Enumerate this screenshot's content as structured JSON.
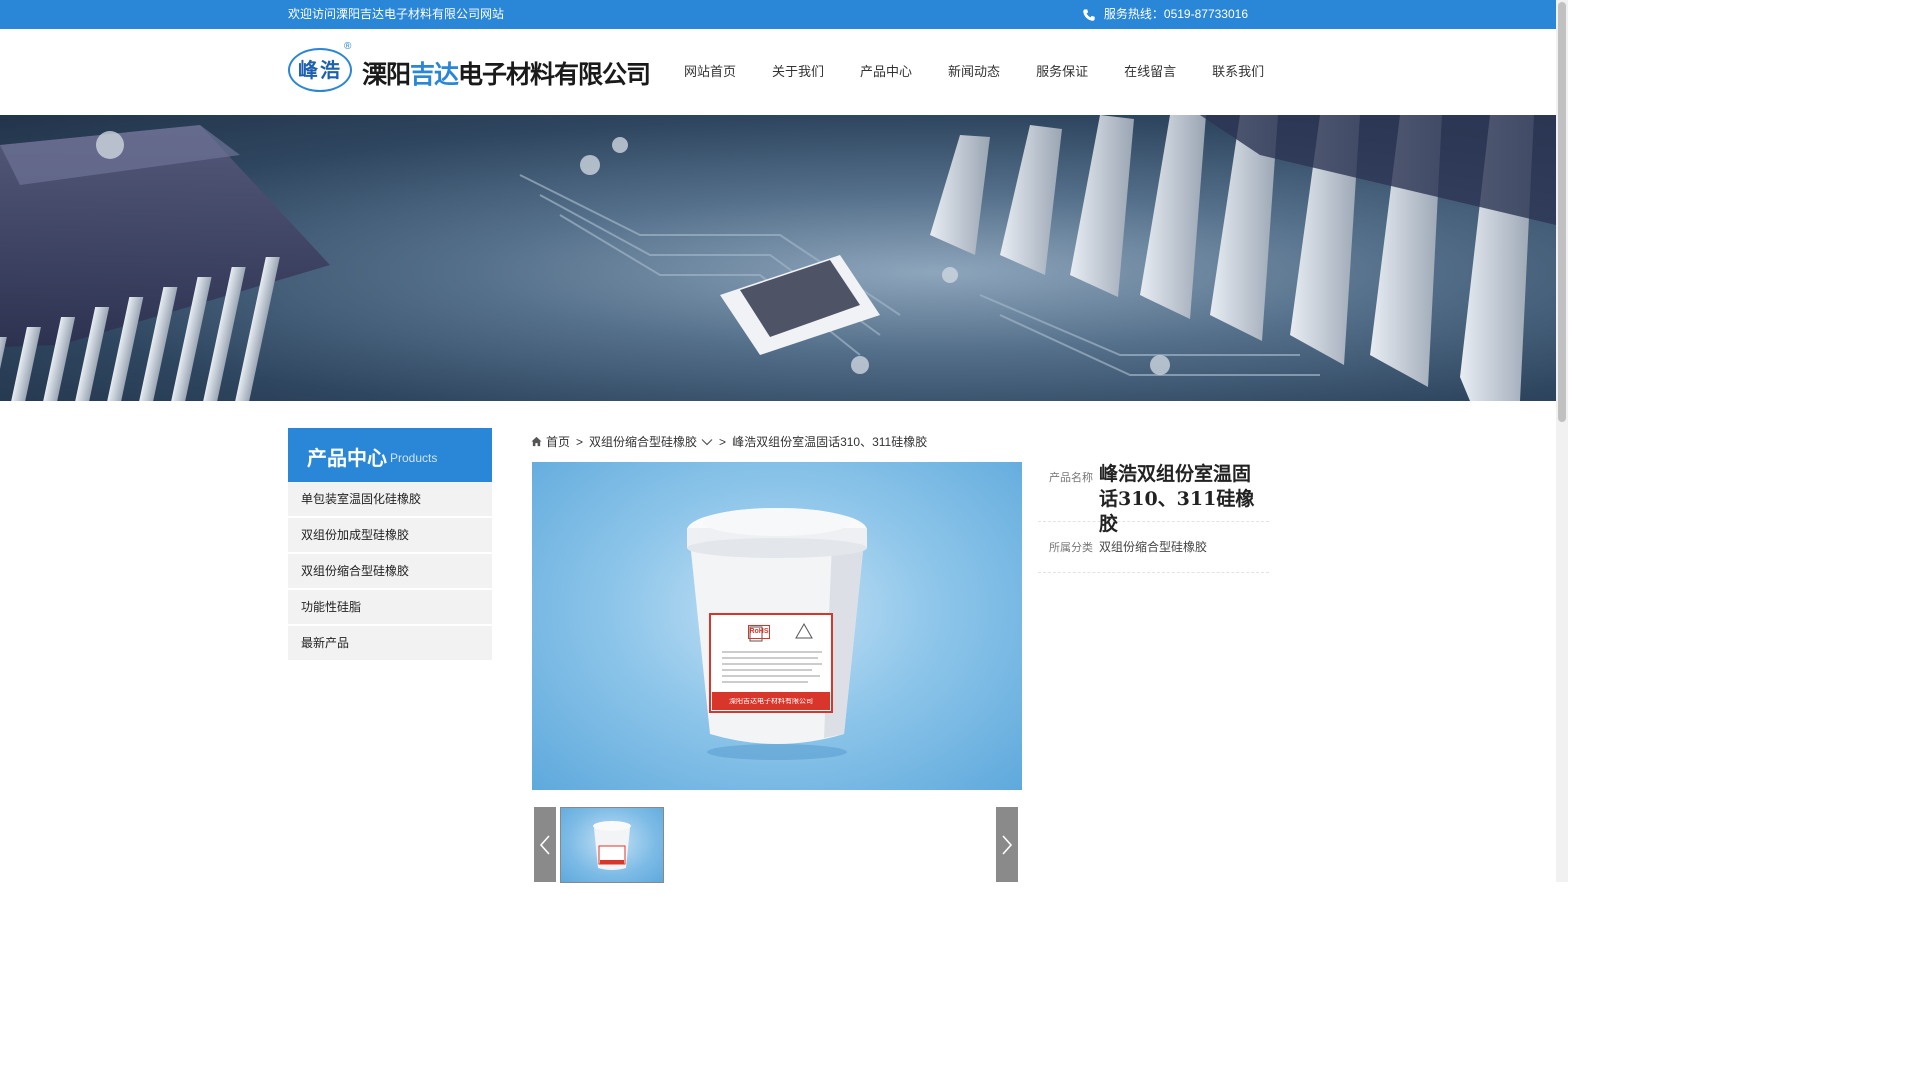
{
  "topbar": {
    "welcome": "欢迎访问溧阳吉达电子材料有限公司网站",
    "hotline": "服务热线：0519-87733016"
  },
  "logo": {
    "seal_text": "峰浩",
    "reg_mark": "®",
    "name_part1": "溧阳",
    "name_part2": "吉达",
    "name_part3": "电子材料有限公司"
  },
  "nav": {
    "items": [
      "网站首页",
      "关于我们",
      "产品中心",
      "新闻动态",
      "服务保证",
      "在线留言",
      "联系我们"
    ]
  },
  "sidebar": {
    "title_cn": "产品中心",
    "title_en": "Products",
    "items": [
      "单包装室温固化硅橡胶",
      "双组份加成型硅橡胶",
      "双组份缩合型硅橡胶",
      "功能性硅脂",
      "最新产品"
    ]
  },
  "breadcrumb": {
    "home": "首页",
    "sep": ">",
    "category": "双组份缩合型硅橡胶",
    "current": "峰浩双组份室温固话310、311硅橡胶"
  },
  "product": {
    "name_label": "产品名称",
    "name": "峰浩双组份室温固话310、311硅橡胶",
    "category_label": "所属分类",
    "category": "双组份缩合型硅橡胶",
    "label_rohs": "RoHS",
    "label_company": "溧阳吉达电子材料有限公司"
  },
  "colors": {
    "brand_blue": "#2a86d6",
    "sidebar_bg": "#f2f2f2",
    "arrow_bg": "#8a8a8a"
  },
  "icons": [
    "phone-icon",
    "home-icon",
    "chevron-down-icon",
    "arrow-left-icon",
    "arrow-right-icon"
  ]
}
